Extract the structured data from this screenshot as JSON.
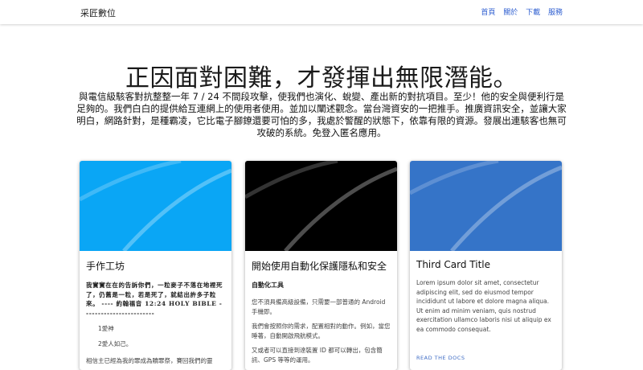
{
  "nav": {
    "brand": "采匠數位",
    "links": [
      "首頁",
      "關於",
      "下載",
      "服務"
    ]
  },
  "hero": {
    "title": "正因面對困難，才發揮出無限潛能。",
    "text": "與電信級駭客對抗整整一年 7 / 24 不間段攻擊，使我們也演化、蛻變、產出新的對抗項目。至少！他的安全與便利行是足夠的。我們白白的提供給互連網上的使用者使用。並加以闡述觀念。當台灣資安的一把推手。推廣資訊安全，並讓大家明白，網路針對，是種霸凌，它比電子腳鐐還要可怕的多，我處於警醒的狀態下，依靠有限的資源。發展出連駭客也無可攻破的系統。免登入匿名應用。"
  },
  "cards": [
    {
      "title": "手作工坊",
      "media_color": "#0aa6f5",
      "verse": "我實實在在的告訴你們，一粒麥子不落在地裡死了，仍舊是一粒，若是死了，就結出許多子粒來。 ---- 約翰福音 12:24 HOLY BIBLE ------------------------",
      "items": [
        "1愛神",
        "2愛人如己。"
      ],
      "tail": "相信主已經為我的罪成為贖罪祭，賽回我們的靈"
    },
    {
      "title": "開始使用自動化保護隱私和安全",
      "media_color": "#000000",
      "lead": "自動化工具",
      "paragraphs": [
        "您不須具備高級設備，只需要一部普通的 Android 手機即。",
        "我們會按照你的需求，配置相對的動作。例如，當您睡著，自動開啟飛航模式。",
        "又或者可以直接到達裝置 ID 都可以轉出，包含簡訊、GPS 等等的運用。"
      ]
    },
    {
      "title": "Third Card Title",
      "media_color": "#3574c8",
      "text": "Lorem ipsum dolor sit amet, consectetur adipiscing elit, sed do eiusmod tempor incididunt ut labore et dolore magna aliqua. Ut enim ad minim veniam, quis nostrud exercitation ullamco laboris nisi ut aliquip ex ea commodo consequat.",
      "link": "READ THE DOCS"
    }
  ]
}
